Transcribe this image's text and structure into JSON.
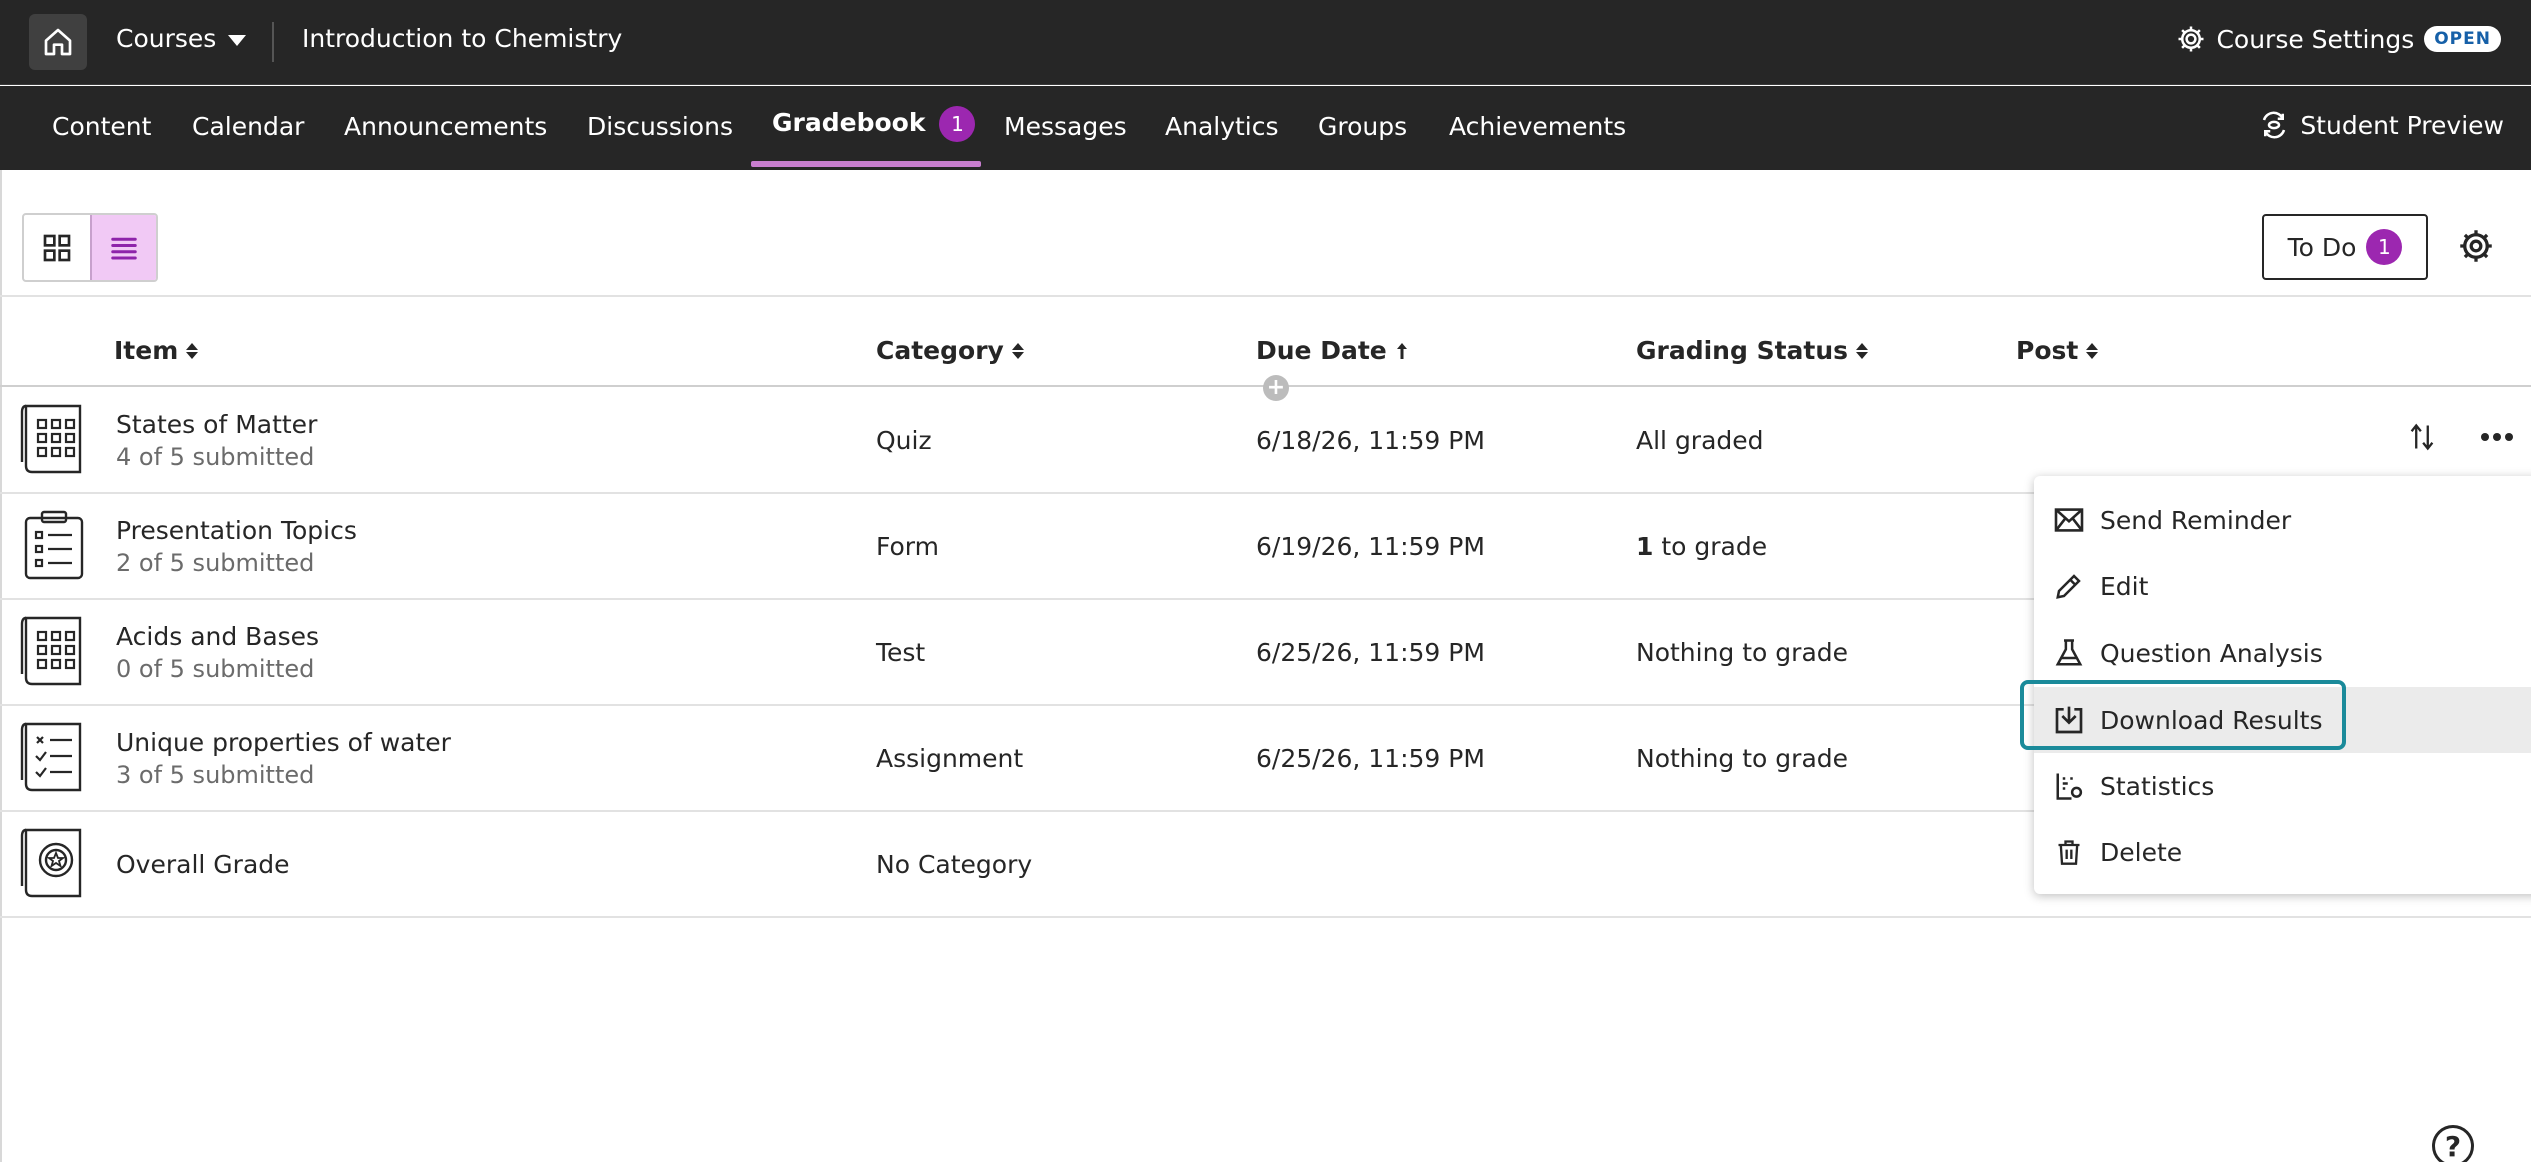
{
  "topbar": {
    "courses_label": "Courses",
    "course_title": "Introduction to Chemistry",
    "settings_label": "Course Settings",
    "status_badge": "OPEN"
  },
  "nav": {
    "tabs": [
      {
        "label": "Content"
      },
      {
        "label": "Calendar"
      },
      {
        "label": "Announcements"
      },
      {
        "label": "Discussions"
      },
      {
        "label": "Gradebook",
        "badge": "1",
        "active": true
      },
      {
        "label": "Messages"
      },
      {
        "label": "Analytics"
      },
      {
        "label": "Groups"
      },
      {
        "label": "Achievements"
      }
    ],
    "student_preview": "Student Preview"
  },
  "toolbar": {
    "todo_label": "To Do",
    "todo_count": "1"
  },
  "table": {
    "headers": {
      "item": "Item",
      "category": "Category",
      "due_date": "Due Date",
      "grading_status": "Grading Status",
      "post": "Post"
    },
    "rows": [
      {
        "icon": "quiz-icon",
        "title": "States of Matter",
        "sub": "4 of 5 submitted",
        "category": "Quiz",
        "due": "6/18/26, 11:59 PM",
        "status": "All graded",
        "status_count": ""
      },
      {
        "icon": "form-icon",
        "title": "Presentation Topics",
        "sub": "2 of 5 submitted",
        "category": "Form",
        "due": "6/19/26, 11:59 PM",
        "status": "to grade",
        "status_count": "1"
      },
      {
        "icon": "test-icon",
        "title": "Acids and Bases",
        "sub": "0 of 5 submitted",
        "category": "Test",
        "due": "6/25/26, 11:59 PM",
        "status": "Nothing to grade",
        "status_count": ""
      },
      {
        "icon": "assignment-icon",
        "title": "Unique properties of water",
        "sub": "3 of 5 submitted",
        "category": "Assignment",
        "due": "6/25/26, 11:59 PM",
        "status": "Nothing to grade",
        "status_count": ""
      },
      {
        "icon": "overall-grade-icon",
        "title": "Overall Grade",
        "sub": "",
        "category": "No Category",
        "due": "",
        "status": "",
        "status_count": ""
      }
    ]
  },
  "menu": {
    "items": [
      {
        "label": "Send Reminder",
        "icon": "envelope-icon"
      },
      {
        "label": "Edit",
        "icon": "pencil-icon"
      },
      {
        "label": "Question Analysis",
        "icon": "flask-icon"
      },
      {
        "label": "Download Results",
        "icon": "download-icon"
      },
      {
        "label": "Statistics",
        "icon": "statistics-icon"
      },
      {
        "label": "Delete",
        "icon": "trash-icon"
      }
    ]
  },
  "help_label": "?"
}
